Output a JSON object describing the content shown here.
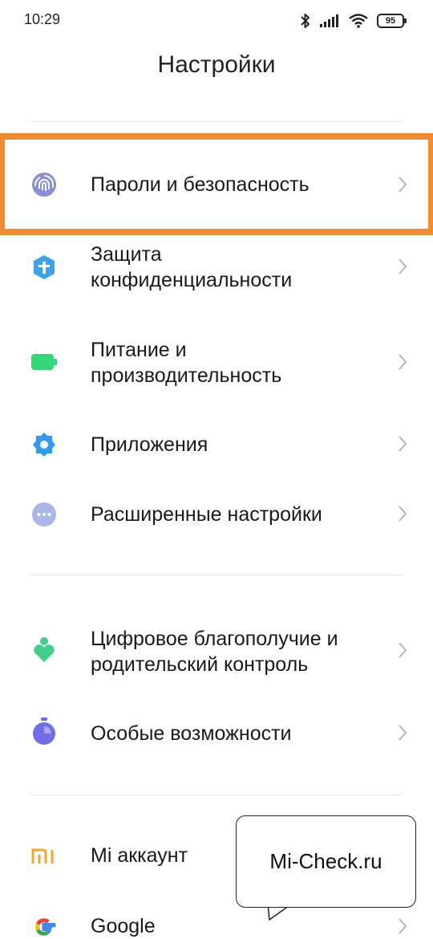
{
  "status_bar": {
    "time": "10:29",
    "battery": "95",
    "icons": [
      "bluetooth-icon",
      "signal-icon",
      "wifi-icon",
      "battery-icon"
    ]
  },
  "header": {
    "title": "Настройки"
  },
  "settings": {
    "items": [
      {
        "label": "Пароли и безопасность",
        "icon": "fingerprint-icon",
        "highlighted": true
      },
      {
        "label": "Защита\nконфиденциальности",
        "icon": "privacy-shield-icon"
      },
      {
        "label": "Питание и\nпроизводительность",
        "icon": "battery-icon"
      },
      {
        "label": "Приложения",
        "icon": "gear-icon"
      },
      {
        "label": "Расширенные настройки",
        "icon": "more-dots-icon"
      },
      {
        "label": "Цифровое благополучие и\nродительский контроль",
        "icon": "wellbeing-icon"
      },
      {
        "label": "Особые возможности",
        "icon": "accessibility-icon"
      },
      {
        "label": "Mi аккаунт",
        "icon": "mi-icon"
      },
      {
        "label": "Google",
        "icon": "google-icon"
      }
    ]
  },
  "watermark": {
    "text": "Mi-Check.ru"
  },
  "colors": {
    "highlight": "#f28a30",
    "fingerprint": "#8a8fd8",
    "privacy": "#3aa3ee",
    "battery": "#34d67a",
    "gear": "#2f9bf0",
    "dots": "#a9b7e8",
    "wellbeing": "#3fd08a",
    "accessibility": "#6f6ee8",
    "mi": "#f5a623"
  }
}
